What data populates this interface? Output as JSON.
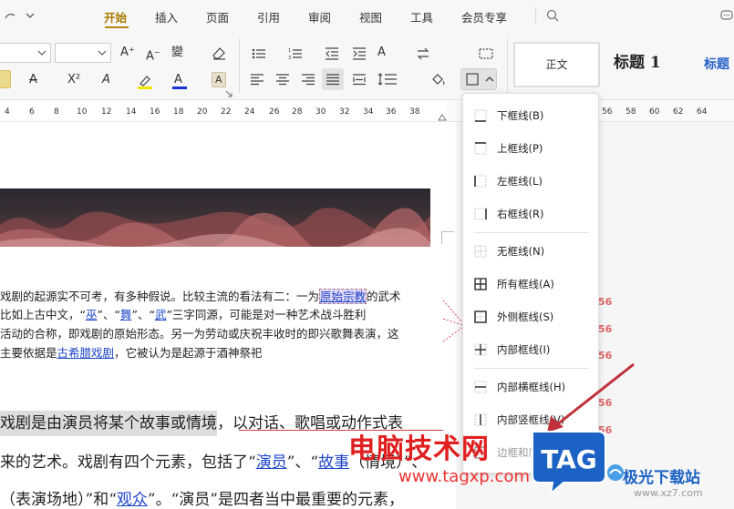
{
  "menubar": {
    "tabs": [
      {
        "label": "开始"
      },
      {
        "label": "插入"
      },
      {
        "label": "页面"
      },
      {
        "label": "引用"
      },
      {
        "label": "审阅"
      },
      {
        "label": "视图"
      },
      {
        "label": "工具"
      },
      {
        "label": "会员专享"
      }
    ]
  },
  "ribbon": {
    "styles": {
      "normal": "正文",
      "heading1": "标题 1",
      "heading2": "标题"
    },
    "font_size_symbol": "A⁺",
    "superscript": "X²",
    "pinyin": "變"
  },
  "ruler": {
    "ticks": [
      "4",
      "6",
      "8",
      "10",
      "12",
      "14",
      "16",
      "18",
      "20",
      "22",
      "24",
      "26",
      "28",
      "30",
      "32",
      "34",
      "36",
      "38",
      "56",
      "58",
      "60",
      "62",
      "64"
    ]
  },
  "document": {
    "para1": {
      "line1": [
        "戏剧的起源实不可考，有多种假说。比较主流的看法有二：一为",
        "原始宗教",
        "的武术"
      ],
      "line2": [
        "比如上古中文，“",
        "巫",
        "”、“",
        "舞",
        "”、“",
        "武",
        "”三字同源，可能是对一种艺术战斗胜利"
      ],
      "line3": "活动的合称，即戏剧的原始形态。另一为劳动或庆祝丰收时的即兴歌舞表演，这",
      "line4": [
        "主要依据是",
        "古希腊戏剧",
        "，它被认为是起源于酒神祭祀"
      ]
    },
    "para2": {
      "line1": [
        "戏剧是由演员将某个故事或情境",
        "，以对话、歌唱或动作式表"
      ],
      "line2": [
        "来的艺术。戏剧有四个元素，包括了“",
        "演员",
        "”、“",
        "故事",
        "（情境）”、"
      ],
      "line3": [
        "（表演场地）”和“",
        "观众",
        "”。“演员”是四者当中最重要的元素，"
      ]
    },
    "margin_numbers": [
      "56",
      "56",
      "56",
      "56",
      "56"
    ]
  },
  "border_menu": {
    "items": [
      {
        "label": "下框线(B)",
        "icon": "bottom-border-icon"
      },
      {
        "label": "上框线(P)",
        "icon": "top-border-icon"
      },
      {
        "label": "左框线(L)",
        "icon": "left-border-icon"
      },
      {
        "label": "右框线(R)",
        "icon": "right-border-icon"
      },
      {
        "label": "无框线(N)",
        "icon": "no-border-icon"
      },
      {
        "label": "所有框线(A)",
        "icon": "all-borders-icon"
      },
      {
        "label": "外侧框线(S)",
        "icon": "outside-borders-icon"
      },
      {
        "label": "内部框线(I)",
        "icon": "inside-borders-icon"
      },
      {
        "label": "内部横框线(H)",
        "icon": "inside-horizontal-border-icon"
      },
      {
        "label": "内部竖框线(V)",
        "icon": "inside-vertical-border-icon"
      },
      {
        "label": "边框和底纹(O)...",
        "icon": "borders-shading-icon"
      }
    ]
  },
  "watermark": {
    "site_name": "电脑技术网",
    "site_url": "www.tagxp.com",
    "tag_text": "TAG",
    "right_name": "极光下载站",
    "right_url": "www.xz7.com"
  },
  "colors": {
    "accent": "#b8860b",
    "link": "#1f46c9",
    "watermark_red": "#e02020",
    "tag_blue": "#1b62c4"
  }
}
